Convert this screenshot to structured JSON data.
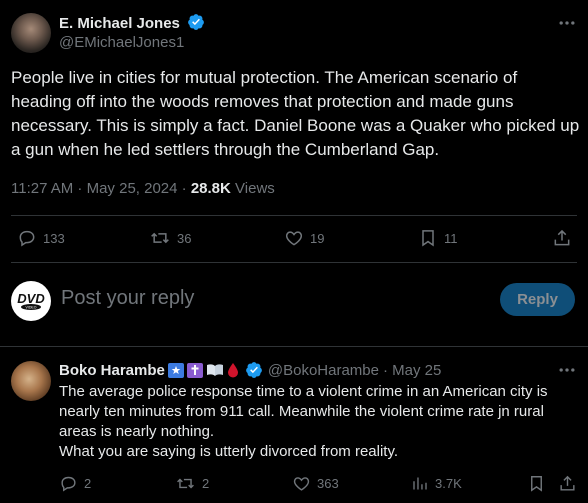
{
  "tweet": {
    "author_name": "E. Michael Jones",
    "handle": "@EMichaelJones1",
    "text": "People live in cities for mutual protection. The American scenario of heading off into the woods removes that protection and made guns necessary. This is simply a fact. Daniel Boone was a Quaker who picked up a gun when he led settlers through the Cumberland Gap.",
    "time": "11:27 AM · May 25, 2024 · ",
    "views_count": "28.8K",
    "views_label": "Views",
    "replies": "133",
    "reposts": "36",
    "likes": "19",
    "bookmarks": "11"
  },
  "composer": {
    "placeholder": "Post your reply",
    "button_label": "Reply"
  },
  "reply": {
    "author_name": "Boko Harambe",
    "handle": "@BokoHarambe",
    "date": "· May 25",
    "text_lines": [
      "The average police response time to a violent crime in an American city is",
      "nearly ten minutes from 911 call. Meanwhile the violent crime rate jn rural",
      "areas is nearly nothing.",
      "What you are saying is utterly divorced from reality."
    ],
    "replies": "2",
    "reposts": "2",
    "likes": "363",
    "views": "3.7K"
  },
  "colors": {
    "background": "#000000",
    "text": "#e7e9ea",
    "muted": "#71767b",
    "verified": "#1d9bf0",
    "reply_button": "#0f4e78",
    "divider": "#2f3336"
  }
}
